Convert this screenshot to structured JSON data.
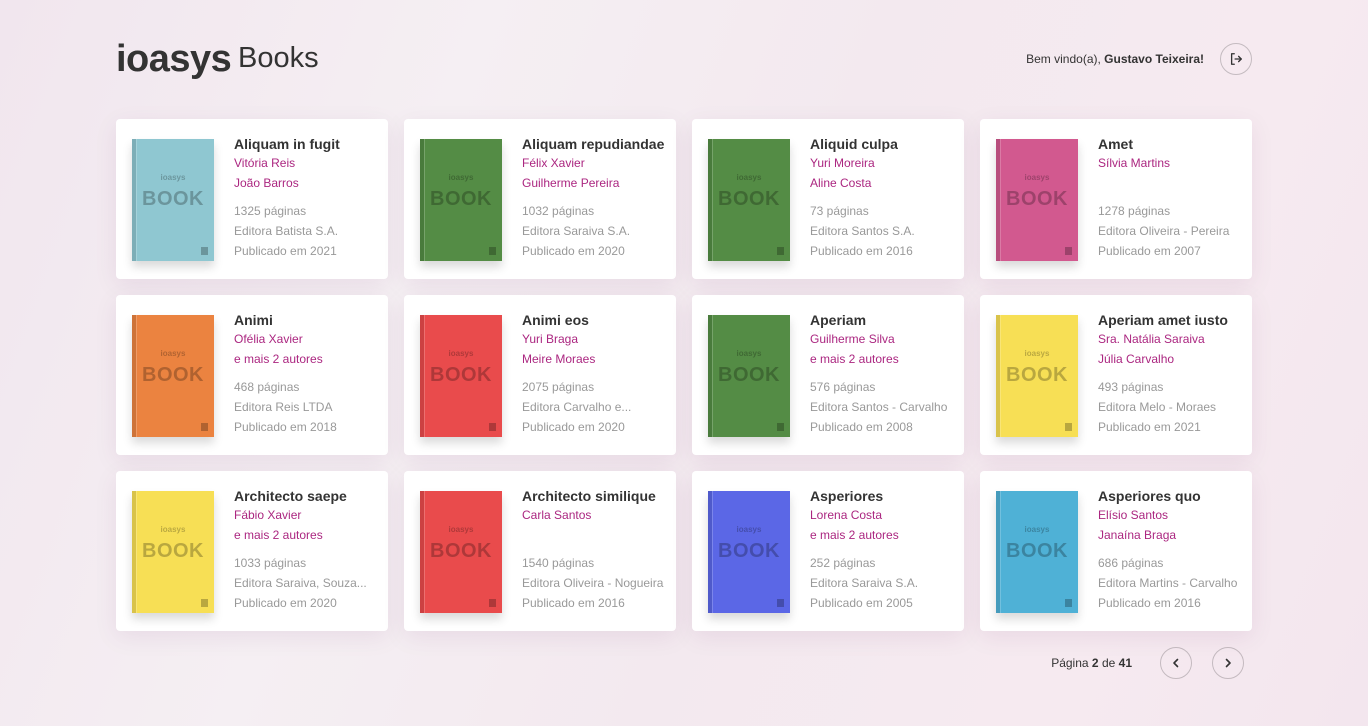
{
  "header": {
    "brand": "ioasys",
    "product": "Books",
    "welcome_prefix": "Bem vindo(a),",
    "user_name": "Gustavo Teixeira!"
  },
  "cover_text": {
    "brand": "ioasys",
    "title": "BOOK"
  },
  "books": [
    {
      "title": "Aliquam in fugit",
      "authors": [
        "Vitória Reis",
        "João Barros"
      ],
      "pages": "1325 páginas",
      "publisher": "Editora Batista S.A.",
      "published": "Publicado em 2021",
      "cover_color": "#8fc7d1"
    },
    {
      "title": "Aliquam repudiandae",
      "authors": [
        "Félix Xavier",
        "Guilherme Pereira"
      ],
      "pages": "1032 páginas",
      "publisher": "Editora Saraiva S.A.",
      "published": "Publicado em 2020",
      "cover_color": "#548c45"
    },
    {
      "title": "Aliquid culpa",
      "authors": [
        "Yuri Moreira",
        "Aline Costa"
      ],
      "pages": "73 páginas",
      "publisher": "Editora Santos S.A.",
      "published": "Publicado em 2016",
      "cover_color": "#548c45"
    },
    {
      "title": "Amet",
      "authors": [
        "Sílvia Martins"
      ],
      "pages": "1278 páginas",
      "publisher": "Editora Oliveira - Pereira",
      "published": "Publicado em 2007",
      "cover_color": "#d2598f"
    },
    {
      "title": "Animi",
      "authors": [
        "Ofélia Xavier",
        "e mais 2 autores"
      ],
      "pages": "468 páginas",
      "publisher": "Editora Reis LTDA",
      "published": "Publicado em 2018",
      "cover_color": "#eb8340"
    },
    {
      "title": "Animi eos",
      "authors": [
        "Yuri Braga",
        "Meire Moraes"
      ],
      "pages": "2075 páginas",
      "publisher": "Editora Carvalho e...",
      "published": "Publicado em 2020",
      "cover_color": "#e94b4c"
    },
    {
      "title": "Aperiam",
      "authors": [
        "Guilherme Silva",
        "e mais 2 autores"
      ],
      "pages": "576 páginas",
      "publisher": "Editora Santos - Carvalho",
      "published": "Publicado em 2008",
      "cover_color": "#548c45"
    },
    {
      "title": "Aperiam amet iusto",
      "authors": [
        "Sra. Natália Saraiva",
        "Júlia Carvalho"
      ],
      "pages": "493 páginas",
      "publisher": "Editora Melo - Moraes",
      "published": "Publicado em 2021",
      "cover_color": "#f7df55"
    },
    {
      "title": "Architecto saepe",
      "authors": [
        "Fábio Xavier",
        "e mais 2 autores"
      ],
      "pages": "1033 páginas",
      "publisher": "Editora Saraiva, Souza...",
      "published": "Publicado em 2020",
      "cover_color": "#f7df55"
    },
    {
      "title": "Architecto similique",
      "authors": [
        "Carla Santos"
      ],
      "pages": "1540 páginas",
      "publisher": "Editora Oliveira - Nogueira",
      "published": "Publicado em 2016",
      "cover_color": "#e94b4c"
    },
    {
      "title": "Asperiores",
      "authors": [
        "Lorena Costa",
        "e mais 2 autores"
      ],
      "pages": "252 páginas",
      "publisher": "Editora Saraiva S.A.",
      "published": "Publicado em 2005",
      "cover_color": "#5b67e6"
    },
    {
      "title": "Asperiores quo",
      "authors": [
        "Elísio Santos",
        "Janaína Braga"
      ],
      "pages": "686 páginas",
      "publisher": "Editora Martins - Carvalho",
      "published": "Publicado em 2016",
      "cover_color": "#4fb1d6"
    }
  ],
  "pagination": {
    "label": "Página",
    "current": "2",
    "separator": "de",
    "total": "41"
  }
}
